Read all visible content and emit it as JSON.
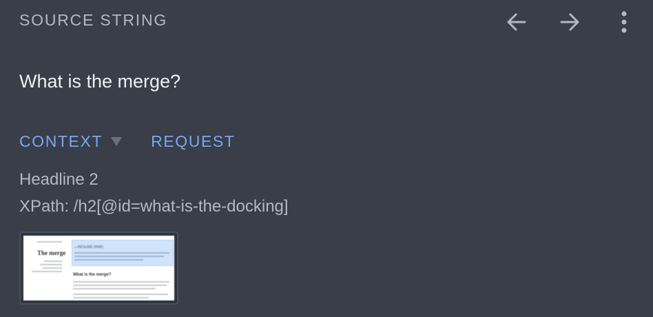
{
  "header": {
    "title": "SOURCE STRING"
  },
  "toolbar": {
    "back_icon": "arrow-left-icon",
    "forward_icon": "arrow-right-icon",
    "more_icon": "more-vert-icon"
  },
  "source": {
    "text": "What is the merge?"
  },
  "tabs": [
    {
      "label": "CONTEXT",
      "has_dropdown": true
    },
    {
      "label": "REQUEST",
      "has_dropdown": false
    }
  ],
  "context": {
    "element_type": "Headline 2",
    "xpath": "XPath: /h2[@id=what-is-the-docking]"
  },
  "screenshot": {
    "title": "The merge",
    "heading": "What is the merge?",
    "highlight_text": "—RÉSUMÉ (RNR)"
  },
  "colors": {
    "background": "#393e48",
    "accent": "#7aa7f2",
    "muted_text": "#b3b8c2",
    "primary_text": "#eceff3"
  }
}
